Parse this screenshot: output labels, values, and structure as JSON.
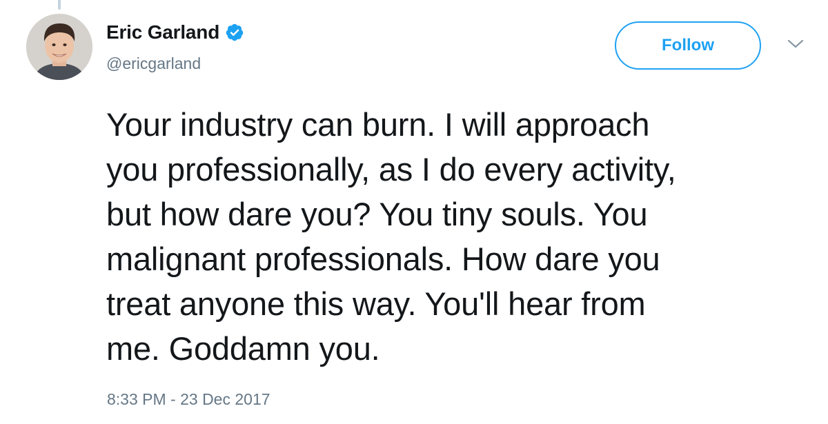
{
  "tweet": {
    "author": {
      "display_name": "Eric Garland",
      "handle": "@ericgarland",
      "verified": true,
      "avatar_icon": "profile-photo"
    },
    "follow_label": "Follow",
    "caret_icon": "chevron-down-icon",
    "text_lines": [
      "Your industry can burn. I will approach",
      "you professionally, as I do every activity,",
      "but how dare you? You tiny souls. You",
      "malignant professionals. How dare you",
      "treat anyone this way. You'll hear from",
      "me. Goddamn you."
    ],
    "timestamp": "8:33 PM - 23 Dec 2017"
  },
  "colors": {
    "accent": "#1da1f2",
    "text": "#14171a",
    "secondary_text": "#657786"
  }
}
